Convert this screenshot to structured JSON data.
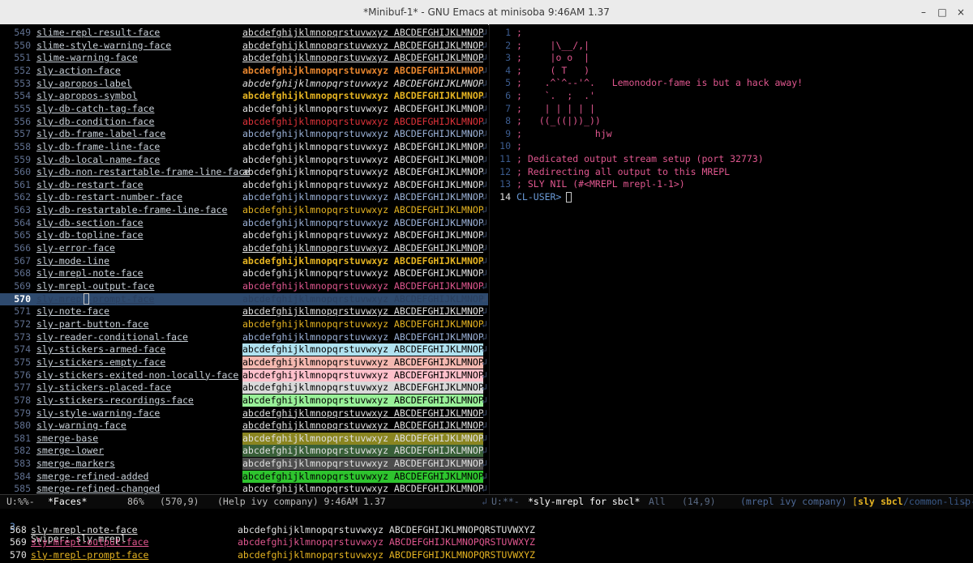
{
  "window": {
    "title": "*Minibuf-1* - GNU Emacs at minisoba 9:46AM 1.37",
    "min_glyph": "–",
    "max_glyph": "□",
    "close_glyph": "×"
  },
  "faces": {
    "sample_text": "abcdefghijklmnopqrstuvwxyz ABCDEFGHIJKLMNOPQR",
    "wrap_glyph": "↲",
    "selected_index": 21,
    "rows": [
      {
        "num": "549",
        "name": "slime-repl-result-face",
        "fg": "#e0e0e0",
        "underline": true
      },
      {
        "num": "550",
        "name": "slime-style-warning-face",
        "fg": "#e0e0e0",
        "underline": true
      },
      {
        "num": "551",
        "name": "slime-warning-face",
        "fg": "#e0e0e0",
        "underline": true
      },
      {
        "num": "552",
        "name": "sly-action-face",
        "fg": "#e8862e",
        "bold": true
      },
      {
        "num": "553",
        "name": "sly-apropos-label",
        "fg": "#e0e0e0",
        "italic": true
      },
      {
        "num": "554",
        "name": "sly-apropos-symbol",
        "fg": "#e6b422",
        "bold": true
      },
      {
        "num": "555",
        "name": "sly-db-catch-tag-face",
        "fg": "#e0e0e0"
      },
      {
        "num": "556",
        "name": "sly-db-condition-face",
        "fg": "#e0333a"
      },
      {
        "num": "557",
        "name": "sly-db-frame-label-face",
        "fg": "#9cb2d8"
      },
      {
        "num": "558",
        "name": "sly-db-frame-line-face",
        "fg": "#e0e0e0"
      },
      {
        "num": "559",
        "name": "sly-db-local-name-face",
        "fg": "#e0e0e0"
      },
      {
        "num": "560",
        "name": "sly-db-non-restartable-frame-line-face",
        "fg": "#e0e0e0"
      },
      {
        "num": "561",
        "name": "sly-db-restart-face",
        "fg": "#e0e0e0"
      },
      {
        "num": "562",
        "name": "sly-db-restart-number-face",
        "fg": "#9cb2d8"
      },
      {
        "num": "563",
        "name": "sly-db-restartable-frame-line-face",
        "fg": "#e6b422"
      },
      {
        "num": "564",
        "name": "sly-db-section-face",
        "fg": "#9cb2d8"
      },
      {
        "num": "565",
        "name": "sly-db-topline-face",
        "fg": "#e0e0e0"
      },
      {
        "num": "566",
        "name": "sly-error-face",
        "fg": "#e0e0e0",
        "underline": true
      },
      {
        "num": "567",
        "name": "sly-mode-line",
        "fg": "#e6b422",
        "bold": true
      },
      {
        "num": "568",
        "name": "sly-mrepl-note-face",
        "fg": "#e0e0e0"
      },
      {
        "num": "569",
        "name": "sly-mrepl-output-face",
        "fg": "#e0578f"
      },
      {
        "num": "570",
        "name": "sly-mrepl-prompt-face",
        "fg": "#2a3f5f",
        "selected": true
      },
      {
        "num": "571",
        "name": "sly-note-face",
        "fg": "#e0e0e0",
        "underline": true
      },
      {
        "num": "572",
        "name": "sly-part-button-face",
        "fg": "#e6b422"
      },
      {
        "num": "573",
        "name": "sly-reader-conditional-face",
        "fg": "#9cb2d8"
      },
      {
        "num": "574",
        "name": "sly-stickers-armed-face",
        "fg": "#000000",
        "bg": "#b0e2f0"
      },
      {
        "num": "575",
        "name": "sly-stickers-empty-face",
        "fg": "#000000",
        "bg": "#f4b8b0"
      },
      {
        "num": "576",
        "name": "sly-stickers-exited-non-locally-face",
        "fg": "#000000",
        "bg": "#ffc0cb"
      },
      {
        "num": "577",
        "name": "sly-stickers-placed-face",
        "fg": "#000000",
        "bg": "#d9d9d9"
      },
      {
        "num": "578",
        "name": "sly-stickers-recordings-face",
        "fg": "#000000",
        "bg": "#98f098"
      },
      {
        "num": "579",
        "name": "sly-style-warning-face",
        "fg": "#e0e0e0",
        "underline": true
      },
      {
        "num": "580",
        "name": "sly-warning-face",
        "fg": "#e0e0e0",
        "underline": true
      },
      {
        "num": "581",
        "name": "smerge-base",
        "fg": "#e0e0e0",
        "bg": "#8a8520"
      },
      {
        "num": "582",
        "name": "smerge-lower",
        "fg": "#e0e0e0",
        "bg": "#385f38"
      },
      {
        "num": "583",
        "name": "smerge-markers",
        "fg": "#e0e0e0",
        "bg": "#4d4d4d"
      },
      {
        "num": "584",
        "name": "smerge-refined-added",
        "fg": "#000000",
        "bg": "#2ec42e"
      },
      {
        "num": "585",
        "name": "smerge-refined-changed",
        "fg": "#e0e0e0"
      }
    ]
  },
  "repl": {
    "lines": [
      {
        "num": "1",
        "text": ";"
      },
      {
        "num": "2",
        "text": ";     |\\__/,|"
      },
      {
        "num": "3",
        "text": ";     |o o  |"
      },
      {
        "num": "4",
        "text": ";     ( T   )"
      },
      {
        "num": "5",
        "text": ";    .^`^--'^.   Lemonodor-fame is but a hack away!"
      },
      {
        "num": "6",
        "text": ";    `.  ;  .'"
      },
      {
        "num": "7",
        "text": ";    | | | | |"
      },
      {
        "num": "8",
        "text": ";   ((_((|))_))"
      },
      {
        "num": "9",
        "text": ";             hjw"
      },
      {
        "num": "10",
        "text": ";"
      },
      {
        "num": "11",
        "text": "; Dedicated output stream setup (port 32773)"
      },
      {
        "num": "12",
        "text": "; Redirecting all output to this MREPL"
      },
      {
        "num": "13",
        "text": "; SLY NIL (#<MREPL mrepl-1-1>)"
      }
    ],
    "prompt_num": "14",
    "prompt": "CL-USER>"
  },
  "modeline": {
    "left_state": "U:%%-",
    "left_buffer": "*Faces*",
    "left_pct": "86%",
    "left_pos": "(570,9)",
    "left_modes": "(Help ivy company) 9:46AM 1.37",
    "right_state": "U:**-",
    "right_buffer": "*sly-mrepl for sbcl*",
    "right_pct": "All",
    "right_pos": "(14,9)",
    "right_modes": "(mrepl ivy company)",
    "right_lisp_open": "[",
    "right_lisp_sly": "sly",
    "right_lisp_sbcl": "sbcl",
    "right_lisp_rest": "/common-lisp-",
    "wrap_glyph": "↲"
  },
  "minibuffer": {
    "count": "3",
    "prompt": "Swiper: sly-mrepl",
    "sample_text": "abcdefghijklmnopqrstuvwxyz ABCDEFGHIJKLMNOPQRSTUVWXYZ",
    "candidates": [
      {
        "num": "568",
        "name": "sly-mrepl-note-face",
        "fg": "#e0e0e0"
      },
      {
        "num": "569",
        "name": "sly-mrepl-output-face",
        "fg": "#e0578f"
      },
      {
        "num": "570",
        "name": "sly-mrepl-prompt-face",
        "fg": "#e6b422"
      }
    ]
  },
  "colors": {
    "selection_bg": "#2e4a6e",
    "prompt_blue": "#6b9bd8",
    "repl_pink": "#e0578f",
    "modeline_bg": "#0a0a0a"
  }
}
